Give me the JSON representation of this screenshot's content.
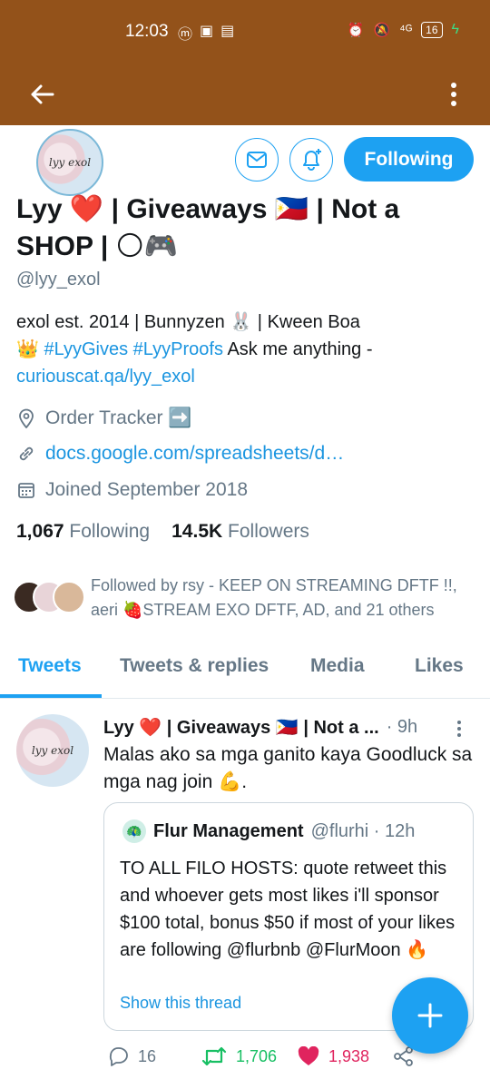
{
  "status_bar": {
    "time": "12:03",
    "network": "⁴ᴳ",
    "battery": "16"
  },
  "profile": {
    "avatar_text": "lyy exol",
    "name": "Lyy ❤️ | Giveaways 🇵🇭 | Not a SHOP | 🌕🎮",
    "handle": "@lyy_exol",
    "follow_label": "Following",
    "bio_line1": "exol est. 2014 |  Bunnyzen 🐰 | Kween Boa",
    "bio_crown": "👑 ",
    "bio_tag1": "#LyyGives",
    "bio_tag2": "#LyyProofs",
    "bio_text": " Ask me anything - ",
    "bio_link": "curiouscat.qa/lyy_exol",
    "location": "Order Tracker ➡️",
    "website": "docs.google.com/spreadsheets/d…",
    "joined": "Joined September 2018",
    "following_count": "1,067",
    "following_label": "Following",
    "followers_count": "14.5K",
    "followers_label": "Followers",
    "followed_by": "Followed by rsy - KEEP ON STREAMING DFTF !!, aeri 🍓STREAM EXO DFTF, AD, and 21 others"
  },
  "tabs": [
    "Tweets",
    "Tweets & replies",
    "Media",
    "Likes"
  ],
  "tweet": {
    "avatar_text": "lyy exol",
    "name": "Lyy ❤️ | Giveaways 🇵🇭 | Not a ...",
    "time": "· 9h",
    "text": "Malas ako sa mga ganito kaya Goodluck sa mga nag join 💪.",
    "quote": {
      "name": "Flur Management",
      "meta": "@flurhi · 12h",
      "text": "TO ALL FILO HOSTS: quote retweet this and whoever gets most likes i'll sponsor $100 total, bonus $50 if most of your likes are following @flurbnb @FlurMoon 🔥",
      "show_thread": "Show this thread"
    },
    "reply_count": "16",
    "retweet_count": "1,706",
    "like_count": "1,938"
  },
  "colors": {
    "app_bar": "#93521a",
    "accent": "#1da1f2",
    "retweet": "#17bf63",
    "like": "#e0245e"
  }
}
